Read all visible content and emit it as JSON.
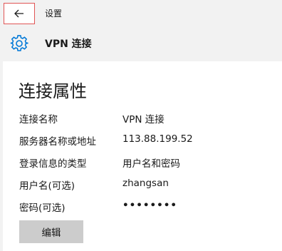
{
  "titlebar": {
    "back_icon": "arrow-left-icon",
    "title": "设置"
  },
  "header": {
    "icon": "gear-icon",
    "title": "VPN 连接"
  },
  "main": {
    "section_title": "连接属性",
    "properties": [
      {
        "label": "连接名称",
        "value": "VPN 连接"
      },
      {
        "label": "服务器名称或地址",
        "value": "113.88.199.52"
      },
      {
        "label": "登录信息的类型",
        "value": "用户名和密码"
      },
      {
        "label": "用户名(可选)",
        "value": "zhangsan"
      },
      {
        "label": "密码(可选)",
        "value": "••••••••"
      }
    ],
    "edit_button": "编辑"
  },
  "colors": {
    "accent": "#0078d7",
    "back_highlight_border": "#e05555",
    "button_bg": "#cccccc"
  }
}
